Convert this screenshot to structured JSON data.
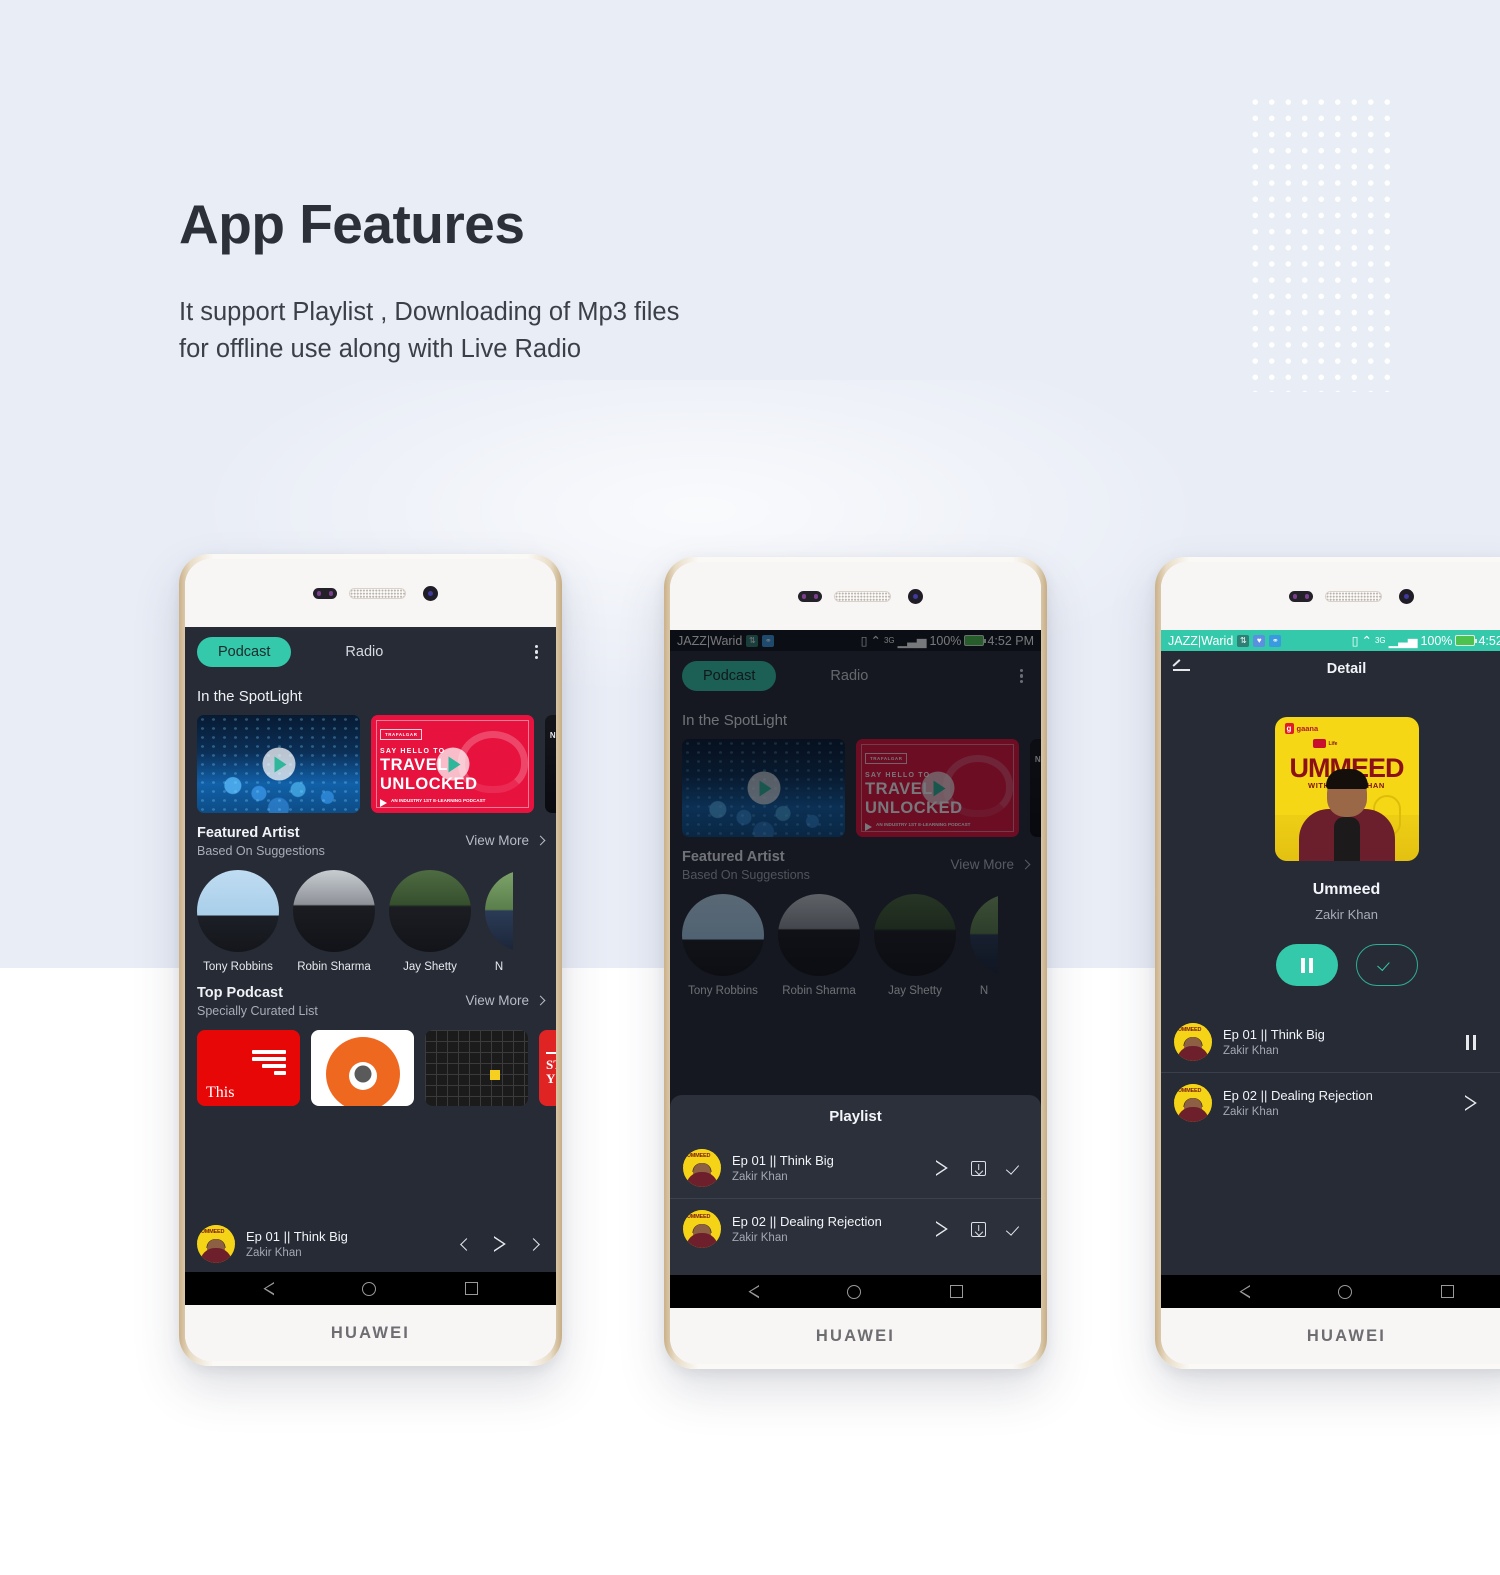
{
  "page": {
    "title": "App Features",
    "subtitle_line1": "It support Playlist , Downloading of Mp3 files",
    "subtitle_line2": "for offline use along with Live Radio",
    "background_top": "#E9EDF6",
    "background_bottom": "#FFFFFF",
    "accent_color": "#35C9AB",
    "dark_screen_color": "#262B35"
  },
  "device": {
    "brand": "HUAWEI"
  },
  "statusbar": {
    "carrier": "JAZZ|Warid",
    "battery": "100%",
    "time": "4:52 PM",
    "network": "3G",
    "icons": [
      "sync-icon",
      "heart-icon",
      "bluetooth-icon",
      "vibrate-icon",
      "wifi-icon",
      "signal-icon",
      "battery-icon"
    ]
  },
  "app": {
    "tabs": {
      "active": "Podcast",
      "inactive": "Radio"
    },
    "overflow_menu": "kebab-menu",
    "spotlight": {
      "title": "In the SpotLight",
      "cards": [
        {
          "id": "concert",
          "label": ""
        },
        {
          "id": "travel-unlocked",
          "badge": "TRAFALGAR",
          "line1": "SAY HELLO TO",
          "line2a": "TRAVEL",
          "line2b": "UNLOCKED",
          "line3": "AN INDUSTRY\n1ST E-LEARNING\nPODCAST"
        },
        {
          "id": "next-card",
          "label": "NE\nFOR\nAM"
        }
      ]
    },
    "featured_artist": {
      "title": "Featured Artist",
      "subtitle": "Based On Suggestions",
      "view_more": "View More",
      "artists": [
        {
          "name": "Tony Robbins"
        },
        {
          "name": "Robin Sharma"
        },
        {
          "name": "Jay Shetty"
        },
        {
          "name": "N"
        }
      ]
    },
    "top_podcast": {
      "title": "Top Podcast",
      "subtitle": "Specially Curated List",
      "view_more": "View More",
      "thumbs": [
        {
          "id": "this-american-life",
          "label": "This"
        },
        {
          "id": "orange-circle",
          "label": ""
        },
        {
          "id": "dark-grid",
          "label": ""
        },
        {
          "id": "stuff-you",
          "line1": "STU",
          "line2": "YO"
        }
      ]
    },
    "mini_player": {
      "title": "Ep 01 || Think Big",
      "artist": "Zakir Khan",
      "controls": [
        "prev-icon",
        "play-icon",
        "next-icon"
      ]
    },
    "playlist_sheet": {
      "title": "Playlist",
      "items": [
        {
          "title": "Ep 01 || Think Big",
          "artist": "Zakir Khan",
          "actions": [
            "play-icon",
            "download-icon",
            "check-icon"
          ]
        },
        {
          "title": "Ep 02 || Dealing Rejection",
          "artist": "Zakir Khan",
          "actions": [
            "play-icon",
            "download-icon",
            "check-icon"
          ]
        }
      ]
    },
    "detail": {
      "header_title": "Detail",
      "back": "back-arrow-icon",
      "podcast_name": "Ummeed",
      "podcast_artist": "Zakir Khan",
      "artwork": {
        "brand": "gaana",
        "brand_mark": "g",
        "presenter": "Life",
        "title": "UMMEED",
        "subtitle": "WITH ZAKIR KHAN"
      },
      "actions": [
        {
          "id": "pause-button",
          "icon": "pause-icon"
        },
        {
          "id": "subscribe-button",
          "icon": "check-icon"
        }
      ],
      "episodes": [
        {
          "title": "Ep 01 || Think Big",
          "artist": "Zakir Khan",
          "actions": [
            "pause-icon",
            "download-icon"
          ]
        },
        {
          "title": "Ep 02 || Dealing Rejection",
          "artist": "Zakir Khan",
          "actions": [
            "play-icon",
            "download-icon"
          ]
        }
      ]
    }
  },
  "navbar": {
    "items": [
      "back-icon",
      "home-icon",
      "recents-icon"
    ]
  }
}
